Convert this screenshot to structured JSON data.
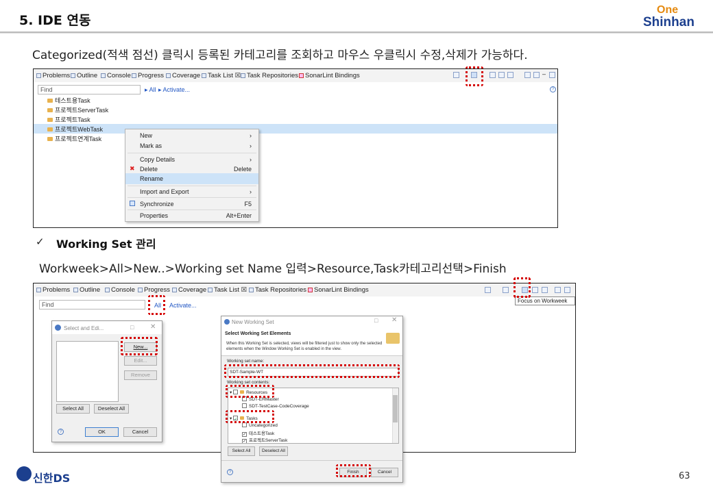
{
  "header": {
    "title": "5. IDE 연동",
    "logo_top": "One",
    "logo_bottom": "Shinhan"
  },
  "intro_text": "Categorized(적색 점선) 클릭시 등록된 카테고리를 조회하고 마우스 우클릭시 수정,삭제가 가능하다.",
  "screen1": {
    "tabs": [
      "Problems",
      "Outline",
      "Console",
      "Progress",
      "Coverage",
      "Task List",
      "Task Repositories",
      "SonarLint Bindings"
    ],
    "find_placeholder": "Find",
    "all_label": "All",
    "activate_label": "Activate...",
    "categories": [
      "테스트용Task",
      "프로젝트ServerTask",
      "프로젝트Task",
      "프로젝트WebTask",
      "프로젝트연계Task"
    ],
    "selected_category_index": 3,
    "context_menu": [
      {
        "label": "New",
        "shortcut": "",
        "submenu": true
      },
      {
        "label": "Mark as",
        "shortcut": "",
        "submenu": true
      },
      {
        "label": "Copy Details",
        "shortcut": "",
        "submenu": true
      },
      {
        "label": "Delete",
        "shortcut": "Delete",
        "submenu": false
      },
      {
        "label": "Rename",
        "shortcut": "",
        "submenu": false,
        "highlighted": true
      },
      {
        "label": "Import and Export",
        "shortcut": "",
        "submenu": true
      },
      {
        "label": "Synchronize",
        "shortcut": "F5",
        "submenu": false
      },
      {
        "label": "Properties",
        "shortcut": "Alt+Enter",
        "submenu": false
      }
    ]
  },
  "working_set": {
    "check": "✓",
    "heading": "Working Set 관리",
    "path": "Workweek>All>New..>Working set Name 입력>Resource,Task카테고리선택>Finish"
  },
  "screen2": {
    "tabs": [
      "Problems",
      "Outline",
      "Console",
      "Progress",
      "Coverage",
      "Task List",
      "Task Repositories",
      "SonarLint Bindings"
    ],
    "find_placeholder": "Find",
    "all_label": "All",
    "activate_label": "Activate...",
    "tooltip": "Focus on Workweek",
    "select_dialog": {
      "title": "Select and Edi...",
      "new_label": "New...",
      "edit_label": "Edit...",
      "remove_label": "Remove",
      "select_all": "Select All",
      "deselect_all": "Deselect All",
      "ok": "OK",
      "cancel": "Cancel"
    },
    "new_ws_dialog": {
      "title": "New Working Set",
      "heading": "Select Working Set Elements",
      "desc": "When this Working Set is selected, views will be filtered just to show only the selected elements when the Window Working Set is enabled in the view.",
      "name_label": "Working set name:",
      "name_value": "SDT-Sample-WT",
      "contents_label": "Working set contents:",
      "tree": [
        {
          "label": "Resources",
          "level": 0,
          "checked": false
        },
        {
          "label": "SDT-ERMaster",
          "level": 1,
          "checked": false
        },
        {
          "label": "SDT-TestCase-CodeCoverage",
          "level": 1,
          "checked": false
        },
        {
          "label": "Tasks",
          "level": 0,
          "checked": true
        },
        {
          "label": "Uncategorized",
          "level": 1,
          "checked": false
        },
        {
          "label": "테스트용Task",
          "level": 1,
          "checked": true
        },
        {
          "label": "프로젝트ServerTask",
          "level": 1,
          "checked": true
        }
      ],
      "select_all": "Select All",
      "deselect_all": "Deselect All",
      "finish": "Finish",
      "cancel": "Cancel"
    }
  },
  "footer": {
    "company": "신한DS",
    "page_number": "63"
  }
}
